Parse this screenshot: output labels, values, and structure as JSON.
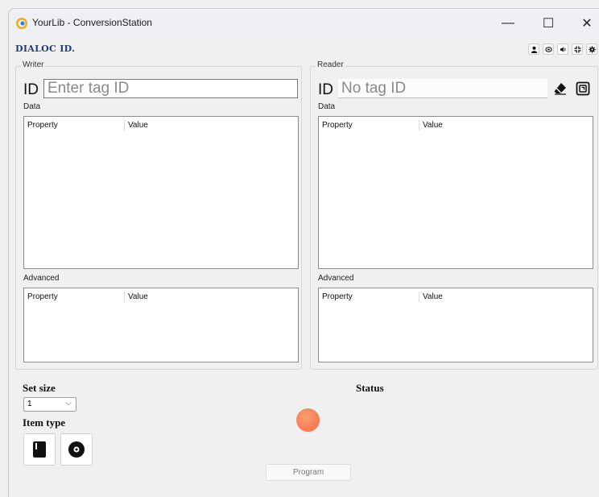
{
  "window": {
    "title": "YourLib - ConversionStation",
    "controls": {
      "minimize": "—",
      "maximize": "☐",
      "close": "✕"
    }
  },
  "logo": {
    "text": "DIALOC ID."
  },
  "toolbar": {
    "icons": [
      "user-icon",
      "layers-icon",
      "sound-icon",
      "compress-icon",
      "gear-icon"
    ]
  },
  "writer": {
    "title": "Writer",
    "id_label": "ID",
    "id_placeholder": "Enter tag ID",
    "id_value": "",
    "data_label": "Data",
    "data_columns": [
      "Property",
      "Value"
    ],
    "advanced_label": "Advanced",
    "advanced_columns": [
      "Property",
      "Value"
    ]
  },
  "reader": {
    "title": "Reader",
    "id_label": "ID",
    "id_placeholder": "No tag ID",
    "id_value": "",
    "data_label": "Data",
    "data_columns": [
      "Property",
      "Value"
    ],
    "advanced_label": "Advanced",
    "advanced_columns": [
      "Property",
      "Value"
    ],
    "icons": [
      "eraser-icon",
      "scan-icon"
    ]
  },
  "set_size": {
    "label": "Set size",
    "selected": "1"
  },
  "item_type": {
    "label": "Item type",
    "options": [
      "book-icon",
      "disc-icon"
    ]
  },
  "status": {
    "label": "Status",
    "color": "#f67a55"
  },
  "program": {
    "label": "Program"
  }
}
